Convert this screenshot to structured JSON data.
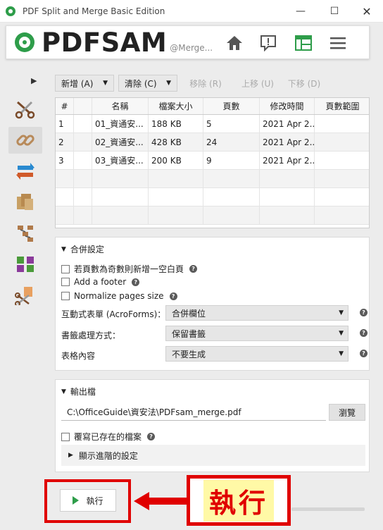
{
  "window": {
    "title": "PDF Split and Merge Basic Edition",
    "minimize_label": "—",
    "maximize_label": "☐",
    "close_label": "✕"
  },
  "header": {
    "logo_pdf": "PDF",
    "logo_sam": "SAM",
    "module_name": "@Merge...",
    "accent_color": "#2e9d4a"
  },
  "sidebar": {
    "toggle": "▶",
    "tools": [
      {
        "name": "split-icon",
        "active": false
      },
      {
        "name": "merge-icon",
        "active": true
      },
      {
        "name": "rotate-icon",
        "active": false
      },
      {
        "name": "alternate-mix-icon",
        "active": false
      },
      {
        "name": "split-by-bookmarks-icon",
        "active": false
      },
      {
        "name": "extract-pages-icon",
        "active": false
      },
      {
        "name": "split-by-size-icon",
        "active": false
      }
    ]
  },
  "toolbar": {
    "add": "新增 (A)",
    "clear": "清除 (C)",
    "move_out": "移除 (R)",
    "move_up": "上移 (U)",
    "move_down": "下移 (D)"
  },
  "table": {
    "columns": [
      "#",
      "",
      "名稱",
      "檔案大小",
      "頁數",
      "修改時間",
      "頁數範圍"
    ],
    "rows": [
      {
        "index": "1",
        "lock": "",
        "name": "01_資通安...",
        "size": "188 KB",
        "pages": "5",
        "modified": "2021 Apr 2...",
        "range": ""
      },
      {
        "index": "2",
        "lock": "",
        "name": "02_資通安...",
        "size": "428 KB",
        "pages": "24",
        "modified": "2021 Apr 2...",
        "range": ""
      },
      {
        "index": "3",
        "lock": "",
        "name": "03_資通安...",
        "size": "200 KB",
        "pages": "9",
        "modified": "2021 Apr 2...",
        "range": ""
      }
    ]
  },
  "merge_settings": {
    "title": "合併設定",
    "blank_page_label": "若頁數為奇數則新增一空白頁",
    "blank_page_checked": false,
    "footer_label": "Add a footer",
    "footer_checked": false,
    "normalize_label": "Normalize pages size",
    "normalize_checked": false,
    "acroforms_label": "互動式表單 (AcroForms)：",
    "acroforms_value": "合併欄位",
    "bookmarks_label": "書籤處理方式：",
    "bookmarks_value": "保留書籤",
    "toc_label": "表格內容",
    "toc_value": "不要生成"
  },
  "output": {
    "title": "輸出檔",
    "path": "C:\\OfficeGuide\\資安法\\PDFsam_merge.pdf",
    "browse": "瀏覽",
    "overwrite_label": "覆寫已存在的檔案",
    "overwrite_checked": false,
    "advanced_label": "顯示進階的設定"
  },
  "run": {
    "label": "執行"
  },
  "annotation": {
    "callout_text": "執行",
    "color": "#e00000",
    "highlight": "#fff9a6"
  }
}
